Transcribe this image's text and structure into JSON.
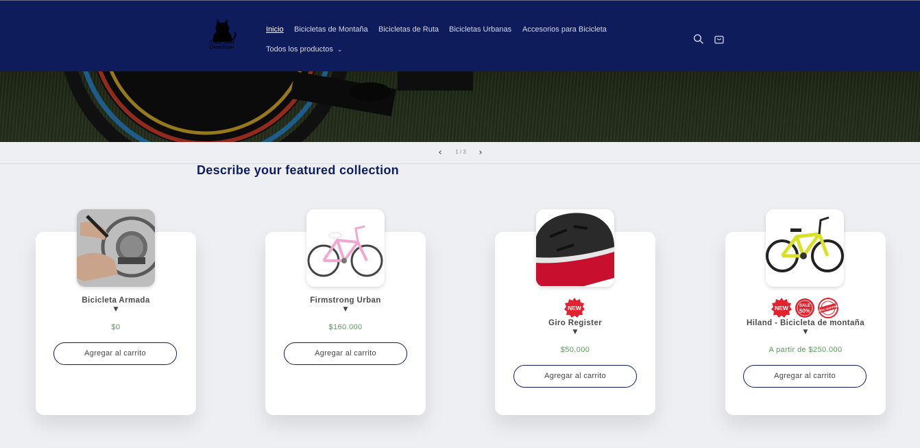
{
  "header": {
    "logo_text": "Gats Web Developer",
    "nav": [
      {
        "label": "Inicio"
      },
      {
        "label": "Bicicletas de Montaña"
      },
      {
        "label": "Bicicletas de Ruta"
      },
      {
        "label": "Bicicletas Urbanas"
      },
      {
        "label": "Accesorios para Bicicleta"
      },
      {
        "label": "Todos los productos"
      }
    ],
    "search_icon": "search-icon",
    "cart_icon": "cart-icon"
  },
  "slider": {
    "counter": "1 / 3",
    "prev_icon": "chevron-left-icon",
    "next_icon": "chevron-right-icon"
  },
  "collection": {
    "title": "Describe your featured collection",
    "products": [
      {
        "name": "Bicicleta Armada",
        "price": "$0",
        "button": "Agregar al carrito",
        "image": "bike-repair-photo"
      },
      {
        "name": "Firmstrong Urban",
        "price": "$160.000",
        "button": "Agregar al carrito",
        "image": "pink-cruiser-bike"
      },
      {
        "name": "Giro Register",
        "price": "$50.000",
        "button": "Agregar al carrito",
        "image": "bike-helmet",
        "badges": [
          "NEW"
        ]
      },
      {
        "name": "Hiland - Bicicleta de montaña",
        "price": "A partir de $250.000",
        "button": "Agregar al carrito",
        "image": "yellow-mountain-bike",
        "badges": [
          "NEW",
          "SALE 50%",
          "FREE SHIPPING"
        ]
      }
    ]
  },
  "colors": {
    "header_bg": "#0e1c5c",
    "price_green": "#5b9a5b",
    "badge_red": "#e0232e"
  }
}
